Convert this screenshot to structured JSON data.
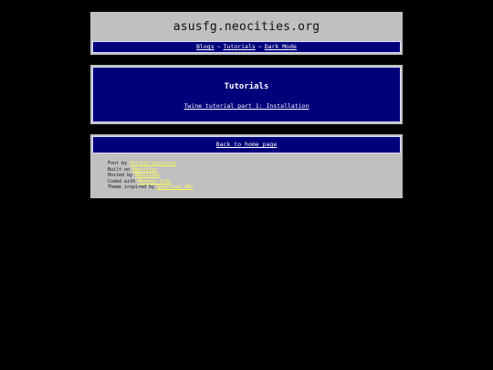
{
  "header": {
    "title": "asusfg.neocities.org",
    "nav": {
      "blogs": "Blogs",
      "sep1": "~",
      "tutorials": "Tutorials",
      "sep2": "~",
      "dark_mode": "Dark Mode"
    }
  },
  "tutorials": {
    "heading": "Tutorials",
    "link": "Twine tutorial part 1: Installation"
  },
  "footer": {
    "home_link": "Back to home page",
    "credits": [
      {
        "label": "Font by ",
        "link": "Patrick Gutierrez"
      },
      {
        "label": "Built on ",
        "link": "Neocities"
      },
      {
        "label": "Hosted by ",
        "link": "Neocities"
      },
      {
        "label": "Coded with ",
        "link": "Phoenix Code"
      },
      {
        "label": "Theme inspired by ",
        "link": "Geocities 90s"
      }
    ]
  },
  "colors": {
    "background": "#000000",
    "panel": "#c0c0c0",
    "nav_blue": "#00007a",
    "credit_link": "#ffff55"
  }
}
